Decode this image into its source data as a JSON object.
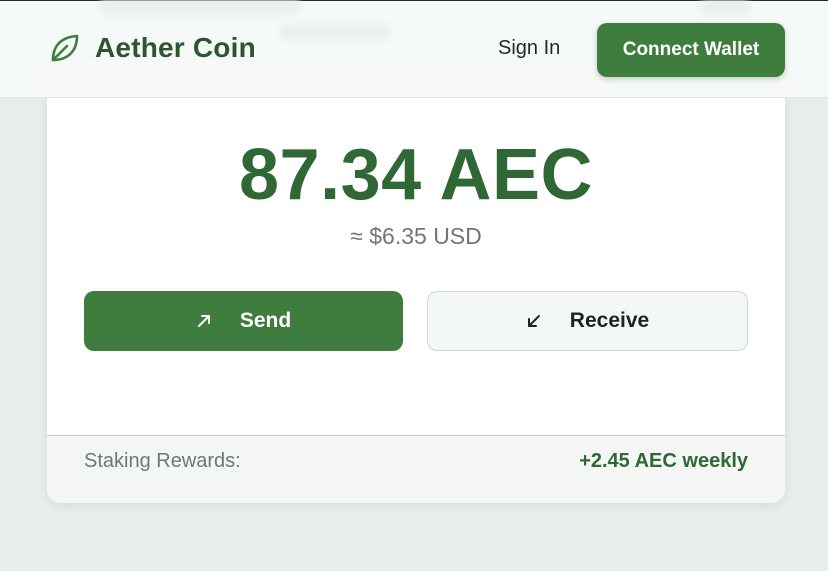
{
  "header": {
    "brand": "Aether Coin",
    "sign_in_label": "Sign In",
    "connect_label": "Connect Wallet",
    "logo_icon": "leaf-icon"
  },
  "balance": {
    "amount": "87.34 AEC",
    "usd": "≈ $6.35 USD"
  },
  "actions": {
    "send_label": "Send",
    "send_icon": "arrow-up-right-icon",
    "receive_label": "Receive",
    "receive_icon": "arrow-down-left-icon"
  },
  "staking": {
    "label": "Staking Rewards:",
    "value": "+2.45 AEC weekly"
  },
  "colors": {
    "brand_green": "#3f7d3f",
    "text_green": "#2f6834",
    "page_bg": "#e7eee9"
  }
}
